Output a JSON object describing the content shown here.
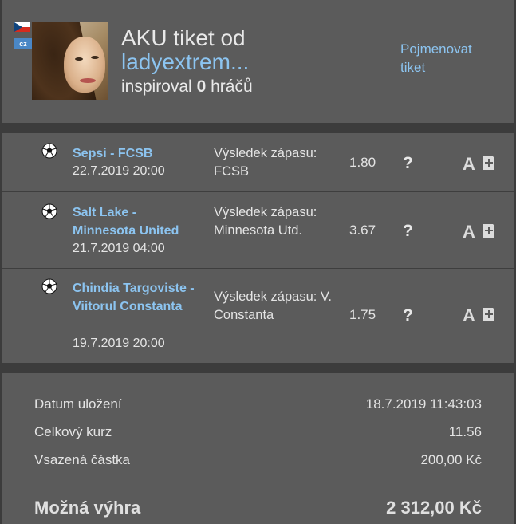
{
  "header": {
    "flag_country": "Czech Republic",
    "country_badge": "cz",
    "title_prefix": "AKU tiket od",
    "username": "ladyextrem...",
    "inspired_prefix": "inspiroval",
    "inspired_count": "0",
    "inspired_suffix": "hráčů",
    "rename_label": "Pojmenovat tiket"
  },
  "bets": [
    {
      "sport_icon": "soccer-ball-icon",
      "match": "Sepsi - FCSB",
      "date": "22.7.2019 20:00",
      "outcome": "Výsledek zápasu: FCSB",
      "odds": "1.80",
      "status": "?",
      "a_label": "A"
    },
    {
      "sport_icon": "soccer-ball-icon",
      "match": "Salt Lake - Minnesota United",
      "date": "21.7.2019 04:00",
      "outcome": "Výsledek zápasu: Minnesota Utd.",
      "odds": "3.67",
      "status": "?",
      "a_label": "A"
    },
    {
      "sport_icon": "soccer-ball-icon",
      "match": "Chindia Targoviste - Viitorul Constanta",
      "date": "19.7.2019 20:00",
      "outcome": "Výsledek zápasu: V. Constanta",
      "odds": "1.75",
      "status": "?",
      "a_label": "A"
    }
  ],
  "summary": {
    "saved_label": "Datum uložení",
    "saved_value": "18.7.2019 11:43:03",
    "total_odds_label": "Celkový kurz",
    "total_odds_value": "11.56",
    "stake_label": "Vsazená částka",
    "stake_value": "200,00 Kč",
    "win_label": "Možná výhra",
    "win_value": "2 312,00 Kč"
  },
  "colors": {
    "link": "#8cc4f0",
    "panel": "#5b5b5b",
    "background": "#3c3c3c"
  }
}
